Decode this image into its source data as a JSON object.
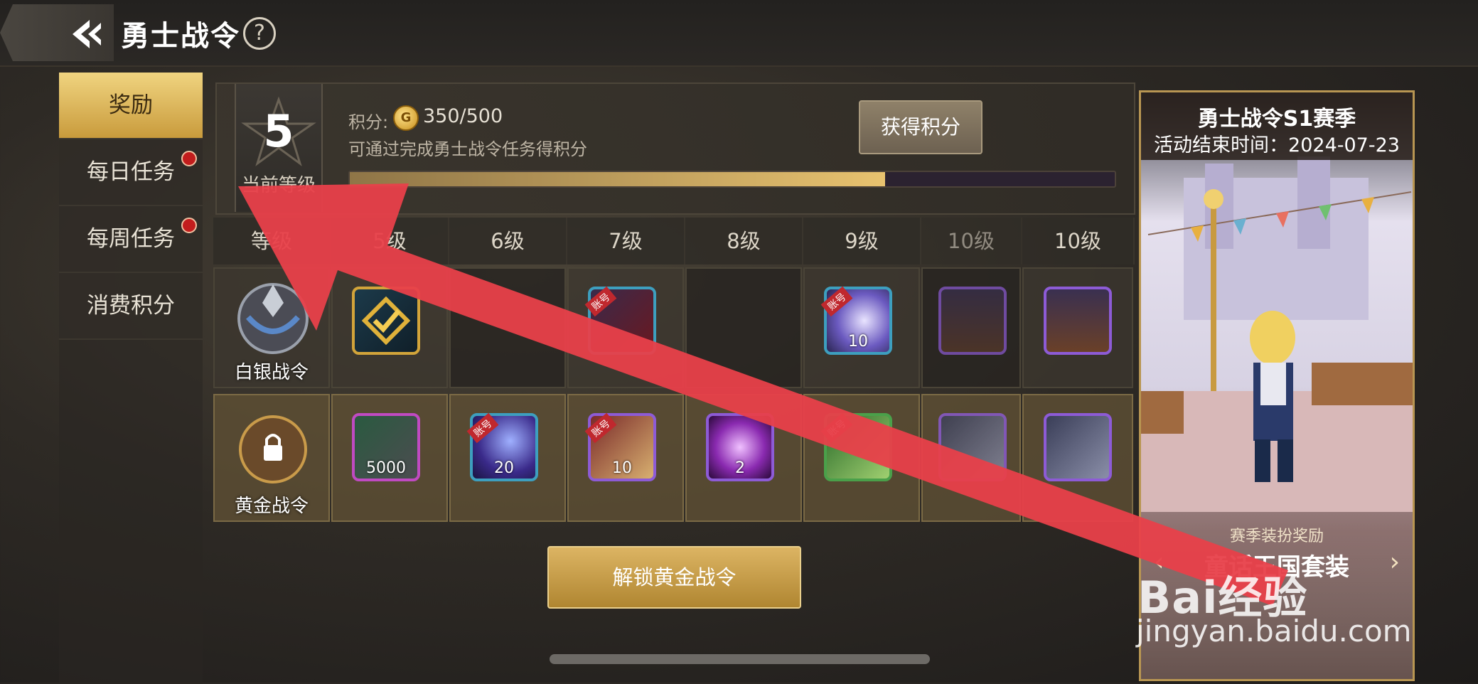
{
  "header": {
    "title": "勇士战令",
    "help": "?"
  },
  "sidebar": {
    "items": [
      {
        "label": "奖励",
        "active": true,
        "dot": false
      },
      {
        "label": "每日任务",
        "active": false,
        "dot": true
      },
      {
        "label": "每周任务",
        "active": false,
        "dot": true
      },
      {
        "label": "消费积分",
        "active": false,
        "dot": false
      }
    ]
  },
  "level": {
    "number": "5",
    "label": "当前等级",
    "points_label": "积分:",
    "coin_symbol": "G",
    "points_value": "350/500",
    "progress": 0.7,
    "hint": "可通过完成勇士战令任务得积分",
    "get_points_button": "获得积分"
  },
  "table": {
    "headers": [
      "等级",
      "5级",
      "6级",
      "7级",
      "8级",
      "9级",
      "10级",
      "10级"
    ],
    "silver_label": "白银战令",
    "gold_label": "黄金战令",
    "silver_items": [
      {
        "count": "",
        "tag": "",
        "color": "gold"
      },
      {
        "count": "",
        "tag": "",
        "color": "none"
      },
      {
        "count": "",
        "tag": "账号",
        "color": "blue"
      },
      {
        "count": "",
        "tag": "",
        "color": "none"
      },
      {
        "count": "10",
        "tag": "账号",
        "color": "blue"
      },
      {
        "count": "",
        "tag": "",
        "color": "purple"
      },
      {
        "count": "",
        "tag": "",
        "color": "purple"
      }
    ],
    "gold_items": [
      {
        "count": "5000",
        "tag": "",
        "color": "pink"
      },
      {
        "count": "20",
        "tag": "账号",
        "color": "blue"
      },
      {
        "count": "10",
        "tag": "账号",
        "color": "purple"
      },
      {
        "count": "2",
        "tag": "",
        "color": "purple"
      },
      {
        "count": "",
        "tag": "账号",
        "color": "blue"
      },
      {
        "count": "",
        "tag": "",
        "color": "purple"
      },
      {
        "count": "",
        "tag": "",
        "color": "purple"
      }
    ]
  },
  "unlock_button": "解锁黄金战令",
  "season": {
    "title": "勇士战令S1赛季",
    "end_time": "活动结束时间：2024-07-23",
    "sub": "赛季装扮奖励",
    "set_name": "童话王国套装"
  },
  "watermark": {
    "logo": "Bai经验",
    "url": "jingyan.baidu.com"
  },
  "colors": {
    "accent_gold": "#d9b15c",
    "arrow_red": "#e8404a"
  }
}
